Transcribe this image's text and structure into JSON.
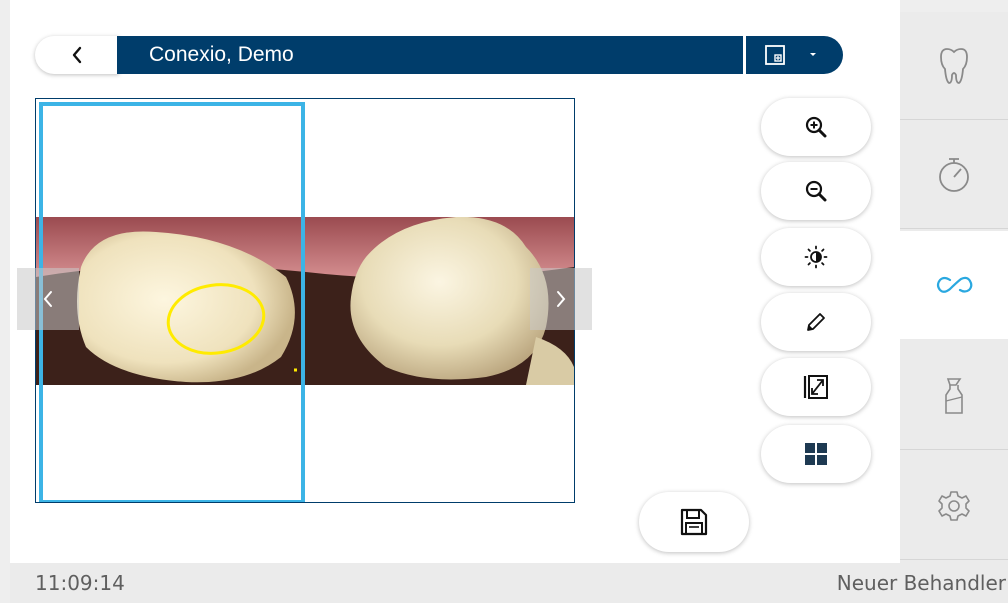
{
  "header": {
    "patient_name": "Conexio, Demo"
  },
  "status_bar": {
    "time": "11:09:14",
    "user": "Neuer Behandler"
  },
  "sidebar": {
    "items": [
      {
        "name": "tooth-icon",
        "active": false
      },
      {
        "name": "timer-icon",
        "active": false
      },
      {
        "name": "intraoral-camera-icon",
        "active": true
      },
      {
        "name": "spray-bottle-icon",
        "active": false
      },
      {
        "name": "settings-gear-icon",
        "active": false
      }
    ]
  },
  "toolbar": {
    "tools": [
      "zoom-in-icon",
      "zoom-out-icon",
      "brightness-icon",
      "pen-icon",
      "fit-to-screen-icon",
      "grid-layout-icon"
    ]
  },
  "colors": {
    "header_bg": "#003d6b",
    "accent": "#3cb4e6",
    "sidebar_bg": "#ebebeb",
    "annotation": "#ffeb00"
  }
}
